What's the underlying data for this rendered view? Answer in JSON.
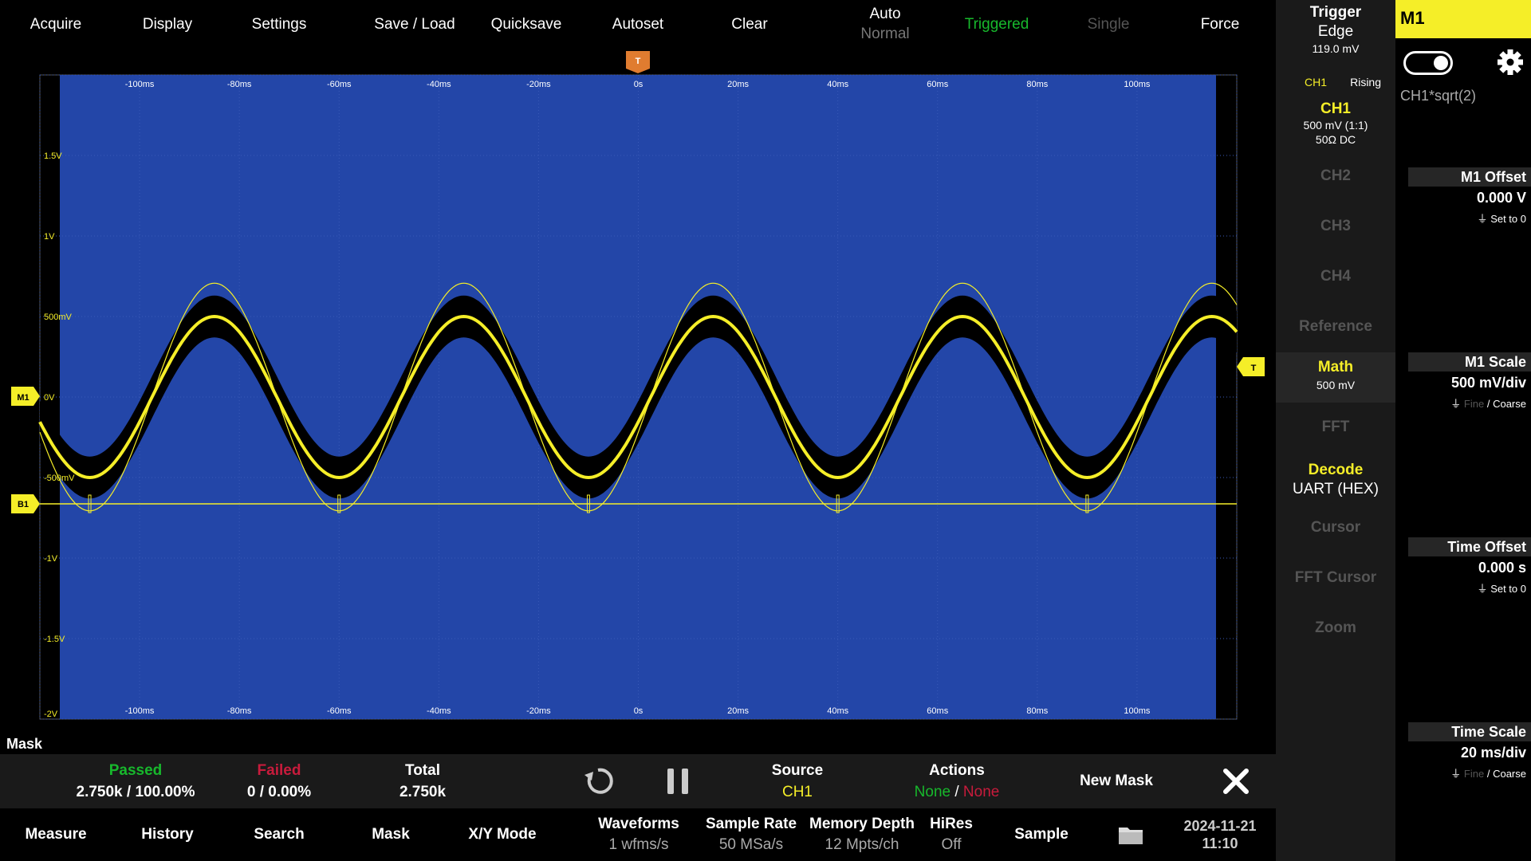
{
  "top_menu": {
    "acquire": "Acquire",
    "display": "Display",
    "settings": "Settings",
    "save_load": "Save / Load",
    "quicksave": "Quicksave",
    "autoset": "Autoset",
    "clear": "Clear",
    "auto": "Auto",
    "normal": "Normal",
    "triggered": "Triggered",
    "single": "Single",
    "force": "Force"
  },
  "trigger": {
    "title": "Trigger",
    "type": "Edge",
    "level": "119.0 mV",
    "source": "CH1",
    "slope": "Rising",
    "marker_label": "T"
  },
  "channels": {
    "ch1": {
      "label": "CH1",
      "scale": "500 mV (1:1)",
      "coupling": "50Ω DC"
    },
    "ch2": "CH2",
    "ch3": "CH3",
    "ch4": "CH4",
    "reference": "Reference",
    "math": {
      "label": "Math",
      "scale": "500 mV"
    },
    "fft": "FFT",
    "decode": {
      "label": "Decode",
      "value": "UART (HEX)"
    },
    "cursor": "Cursor",
    "fft_cursor": "FFT Cursor",
    "zoom": "Zoom"
  },
  "math_panel": {
    "title": "M1",
    "expression": "CH1*sqrt(2)",
    "offset_title": "M1 Offset",
    "offset_value": "0.000 V",
    "offset_action": "Set to 0",
    "scale_title": "M1 Scale",
    "scale_value": "500 mV/div",
    "fine": "Fine",
    "coarse": "Coarse",
    "sep": "/"
  },
  "timebase": {
    "offset_title": "Time Offset",
    "offset_value": "0.000 s",
    "offset_action": "Set to 0",
    "scale_title": "Time Scale",
    "scale_value": "20 ms/div",
    "fine": "Fine",
    "coarse": "Coarse",
    "sep": "/"
  },
  "plot": {
    "x_labels": [
      "-100ms",
      "-80ms",
      "-60ms",
      "-40ms",
      "-20ms",
      "0s",
      "20ms",
      "40ms",
      "60ms",
      "80ms",
      "100ms"
    ],
    "y_labels": [
      "1.5V",
      "1V",
      "500mV",
      "0V",
      "-500mV",
      "-1V",
      "-1.5V",
      "-2V"
    ],
    "marker_m1": "M1",
    "marker_b1": "B1",
    "marker_t": "T",
    "signal": {
      "ch1_amplitude_v": 0.5,
      "m1_amplitude_v": 0.707,
      "period_ms": 50,
      "phase_peak_ms": 15
    }
  },
  "mask": {
    "header": "Mask",
    "passed_label": "Passed",
    "passed_value": "2.750k / 100.00%",
    "failed_label": "Failed",
    "failed_value": "0 / 0.00%",
    "total_label": "Total",
    "total_value": "2.750k",
    "source_label": "Source",
    "source_value": "CH1",
    "actions_label": "Actions",
    "actions_pass": "None",
    "actions_sep": "/",
    "actions_fail": "None",
    "new_mask": "New Mask"
  },
  "bottom_menu": {
    "measure": "Measure",
    "history": "History",
    "search": "Search",
    "mask": "Mask",
    "xy": "X/Y Mode",
    "waveforms_label": "Waveforms",
    "waveforms_value": "1 wfms/s",
    "sample_rate_label": "Sample Rate",
    "sample_rate_value": "50 MSa/s",
    "memory_label": "Memory Depth",
    "memory_value": "12 Mpts/ch",
    "hires_label": "HiRes",
    "hires_value": "Off",
    "sample": "Sample",
    "date": "2024-11-21",
    "time": "11:10"
  },
  "colors": {
    "ch1": "#f5ee28",
    "mask_blue": "#2346a8",
    "triggered": "#17b82c",
    "failed": "#c81b3c",
    "trigger_marker": "#e07c30"
  }
}
